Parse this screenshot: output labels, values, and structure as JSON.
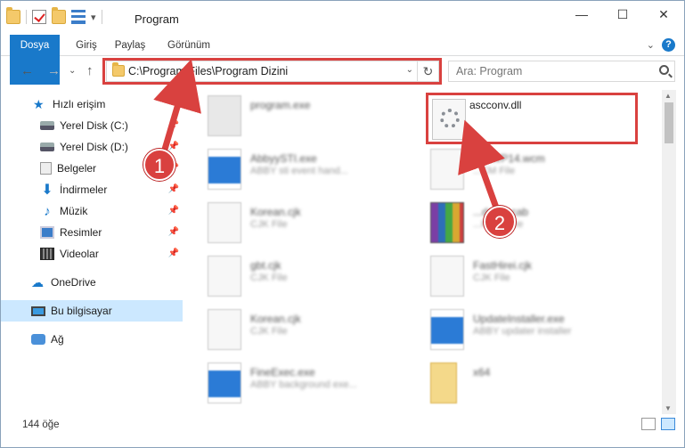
{
  "window": {
    "title": "Program"
  },
  "window_buttons": {
    "minimize": "—",
    "maximize": "☐",
    "close": "✕"
  },
  "ribbon": {
    "tabs": [
      "Dosya",
      "Giriş",
      "Paylaş",
      "Görünüm"
    ],
    "expand": "⌄",
    "help": "?"
  },
  "nav": {
    "back": "←",
    "forward": "→",
    "recent": "⌄",
    "up": "↑",
    "address": "C:\\Program Files\\Program Dizini",
    "dropdown": "⌄",
    "refresh": "↻",
    "search_placeholder": "Ara: Program"
  },
  "sidebar": {
    "items": [
      {
        "label": "Hızlı erişim",
        "icon": "star-icon"
      },
      {
        "label": "Yerel Disk (C:)",
        "icon": "disk-icon",
        "pinned": true
      },
      {
        "label": "Yerel Disk (D:)",
        "icon": "disk-icon",
        "pinned": true
      },
      {
        "label": "Belgeler",
        "icon": "documents-icon",
        "pinned": true
      },
      {
        "label": "İndirmeler",
        "icon": "download-icon",
        "pinned": true
      },
      {
        "label": "Müzik",
        "icon": "music-icon",
        "pinned": true
      },
      {
        "label": "Resimler",
        "icon": "pictures-icon",
        "pinned": true
      },
      {
        "label": "Videolar",
        "icon": "videos-icon",
        "pinned": true
      },
      {
        "label": "OneDrive",
        "icon": "cloud-icon"
      },
      {
        "label": "Bu bilgisayar",
        "icon": "computer-icon",
        "selected": true
      },
      {
        "label": "Ağ",
        "icon": "network-icon"
      }
    ],
    "pin_glyph": "📌"
  },
  "files": [
    {
      "name": "program.exe",
      "desc": "",
      "blurred": true
    },
    {
      "name": "ascconv.dll",
      "desc": "",
      "blurred": false,
      "highlighted": true
    },
    {
      "name": "AbbyySTI.exe",
      "desc": "ABBY sti event hand...",
      "blurred": true
    },
    {
      "name": "...toWP14.wcm",
      "desc": "...CM File",
      "blurred": true
    },
    {
      "name": "Korean.cjk",
      "desc": "CJK File",
      "blurred": true
    },
    {
      "name": "...dates.cab",
      "desc": "...R Archive",
      "blurred": true
    },
    {
      "name": "gbt.cjk",
      "desc": "CJK File",
      "blurred": true
    },
    {
      "name": "FastHirei.cjk",
      "desc": "CJK File",
      "blurred": true
    },
    {
      "name": "Korean.cjk",
      "desc": "CJK File",
      "blurred": true
    },
    {
      "name": "UpdateInstaller.exe",
      "desc": "ABBY updater installer",
      "blurred": true
    },
    {
      "name": "FineExec.exe",
      "desc": "ABBY background exe...",
      "blurred": true
    },
    {
      "name": "x64",
      "desc": "",
      "blurred": true
    }
  ],
  "status": {
    "count": "144 öğe"
  },
  "callouts": [
    "1",
    "2"
  ],
  "colors": {
    "accent": "#1979ca",
    "highlight_red": "#d9413f",
    "selected_bg": "#cce8ff"
  }
}
